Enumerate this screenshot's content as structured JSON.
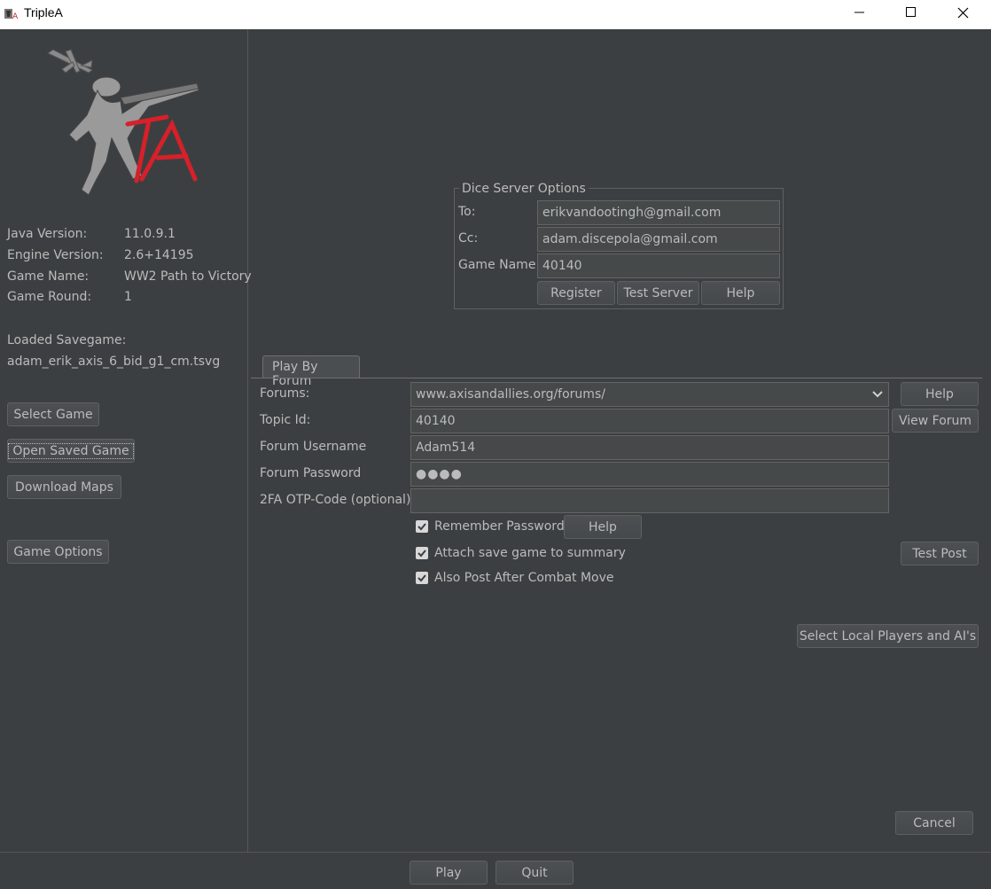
{
  "window": {
    "title": "TripleA",
    "minimize_glyph": "—",
    "maximize_glyph": "☐",
    "close_glyph": "✕"
  },
  "game_info": {
    "java_version_label": "Java Version:",
    "java_version": "11.0.9.1",
    "engine_version_label": "Engine Version:",
    "engine_version": "2.6+14195",
    "game_name_label": "Game Name:",
    "game_name": "WW2 Path to Victory",
    "game_round_label": "Game Round:",
    "game_round": "1",
    "loaded_savegame_label": "Loaded Savegame:",
    "loaded_savegame": "adam_erik_axis_6_bid_g1_cm.tsvg"
  },
  "left_buttons": {
    "select_game": "Select Game",
    "open_saved_game": "Open Saved Game",
    "download_maps": "Download Maps",
    "game_options": "Game Options"
  },
  "dice_server": {
    "legend": "Dice Server Options",
    "to_label": "To:",
    "to_value": "erikvandootingh@gmail.com",
    "cc_label": "Cc:",
    "cc_value": "adam.discepola@gmail.com",
    "game_name_label": "Game Name:",
    "game_name_value": "40140",
    "register": "Register",
    "test_server": "Test Server",
    "help": "Help"
  },
  "forum": {
    "tab_label": "Play By Forum",
    "forums_label": "Forums:",
    "forums_value": "www.axisandallies.org/forums/",
    "help": "Help",
    "topic_label": "Topic Id:",
    "topic_value": "40140",
    "view_forum": "View Forum",
    "username_label": "Forum Username",
    "username_value": "Adam514",
    "password_label": "Forum Password",
    "password_value": "●●●●",
    "otp_label": "2FA OTP-Code (optional)",
    "otp_value": "",
    "remember_password": "Remember Password",
    "remember_help": "Help",
    "attach_save": "Attach save game to summary",
    "test_post": "Test Post",
    "also_post": "Also Post After Combat Move",
    "remember_checked": true,
    "attach_checked": true,
    "also_post_checked": true
  },
  "actions": {
    "select_local_players": "Select Local Players and AI's",
    "cancel": "Cancel",
    "play": "Play",
    "quit": "Quit"
  },
  "colors": {
    "background": "#3c3f41",
    "text": "#bbbbbb",
    "logo_red": "#d6202a"
  }
}
